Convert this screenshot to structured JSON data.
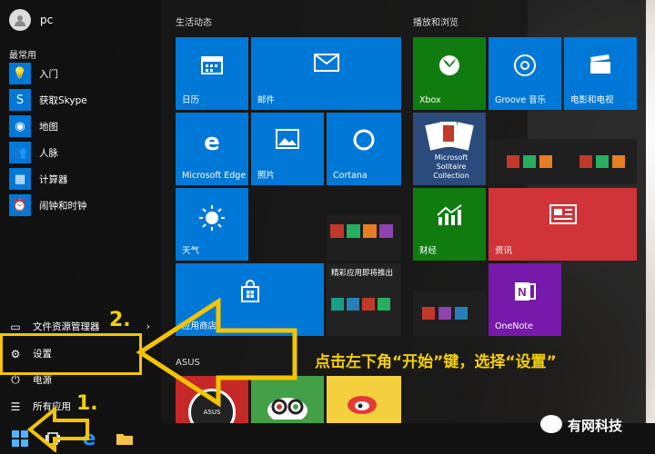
{
  "user": {
    "name": "pc"
  },
  "left": {
    "most_used_title": "最常用",
    "apps": [
      {
        "label": "入门",
        "icon": "lightbulb-icon",
        "glyph": "💡"
      },
      {
        "label": "获取Skype",
        "icon": "skype-icon",
        "glyph": "S"
      },
      {
        "label": "地图",
        "icon": "map-icon",
        "glyph": "◉"
      },
      {
        "label": "人脉",
        "icon": "people-icon",
        "glyph": "👥"
      },
      {
        "label": "计算器",
        "icon": "calculator-icon",
        "glyph": "▦"
      },
      {
        "label": "闹钟和时钟",
        "icon": "alarm-icon",
        "glyph": "⏰"
      }
    ],
    "bottom": [
      {
        "label": "文件资源管理器",
        "icon": "folder-icon",
        "glyph": "▭",
        "arrow": "›"
      },
      {
        "label": "设置",
        "icon": "gear-icon",
        "glyph": "⚙"
      },
      {
        "label": "电源",
        "icon": "power-icon",
        "glyph": "⏻"
      },
      {
        "label": "所有应用",
        "icon": "list-icon",
        "glyph": "☰"
      }
    ]
  },
  "groups": {
    "life": "生活动态",
    "play": "播放和浏览",
    "asus": "ASUS"
  },
  "tiles": {
    "calendar": "日历",
    "mail": "邮件",
    "edge": "Microsoft Edge",
    "photos": "照片",
    "cortana": "Cortana",
    "weather": "天气",
    "store": "应用商店",
    "featured": "精彩应用即将推出",
    "xbox": "Xbox",
    "groove": "Groove 音乐",
    "movies": "电影和电视",
    "solitaire": "Microsoft Solitaire Collection",
    "finance": "财经",
    "news": "资讯",
    "onenote": "OneNote",
    "giftbox": "ASUS GIFTBOX"
  },
  "annotations": {
    "step1": "1.",
    "step2": "2.",
    "caption": "点击左下角“开始”键，选择“设置”",
    "yellow": "#f5c400"
  },
  "watermark": "有网科技",
  "colors": {
    "tile_blue": "#0078d7",
    "xbox_green": "#107c10",
    "news_red": "#d13438",
    "onenote_purple": "#7719aa"
  }
}
